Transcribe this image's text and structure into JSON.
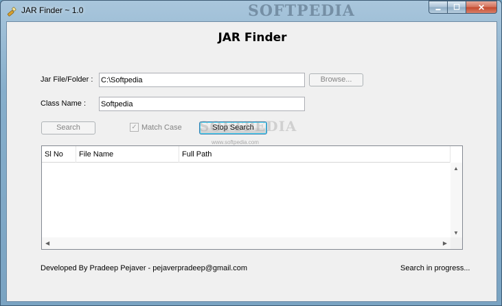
{
  "window": {
    "title": "JAR Finder ~ 1.0",
    "watermark": "SOFTPEDIA",
    "controls": {
      "minimize": "▬",
      "maximize": "☐",
      "close": "✕"
    }
  },
  "app": {
    "heading": "JAR Finder",
    "jar_label": "Jar File/Folder :",
    "jar_value": "C:\\Softpedia",
    "browse_label": "Browse...",
    "class_label": "Class Name :",
    "class_value": "Softpedia",
    "search_label": "Search",
    "match_case_label": "Match Case",
    "match_case_checked": true,
    "stop_search_label": "Stop Search",
    "watermark_text": "SOFTPEDIA",
    "watermark_url": "www.softpedia.com"
  },
  "results": {
    "columns": [
      "Sl No",
      "File Name",
      "Full Path"
    ],
    "rows": []
  },
  "footer": {
    "developer": "Developed By Pradeep Pejaver - pejaverpradeep@gmail.com",
    "status": "Search in progress..."
  }
}
